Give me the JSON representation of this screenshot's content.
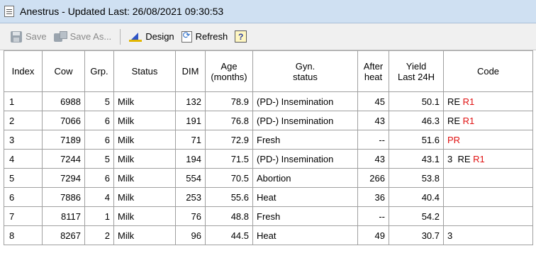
{
  "window": {
    "title": "Anestrus - Updated Last: 26/08/2021 09:30:53"
  },
  "toolbar": {
    "save_label": "Save",
    "save_as_label": "Save As...",
    "design_label": "Design",
    "refresh_label": "Refresh",
    "help_label": "?"
  },
  "icons": {
    "save": "save-icon",
    "save_as": "save-as-icon",
    "design": "design-icon",
    "refresh": "refresh-icon",
    "help": "help-icon",
    "window": "document-icon"
  },
  "colors": {
    "title_bar": "#cfe0f2",
    "code_highlight": "#e01010"
  },
  "table": {
    "headers": {
      "index": "Index",
      "cow": "Cow",
      "grp": "Grp.",
      "status": "Status",
      "dim": "DIM",
      "age_1": "Age",
      "age_2": "(months)",
      "gyn_1": "Gyn.",
      "gyn_2": "status",
      "after_1": "After",
      "after_2": "heat",
      "yield_1": "Yield",
      "yield_2": "Last 24H",
      "code": "Code"
    },
    "rows": [
      {
        "index": "1",
        "cow": "6988",
        "grp": "5",
        "status": "Milk",
        "dim": "132",
        "age": "78.9",
        "gyn": "(PD-) Insemination",
        "after_heat": "45",
        "yield": "50.1",
        "code_black": "RE ",
        "code_red": "R1"
      },
      {
        "index": "2",
        "cow": "7066",
        "grp": "6",
        "status": "Milk",
        "dim": "191",
        "age": "76.8",
        "gyn": "(PD-) Insemination",
        "after_heat": "43",
        "yield": "46.3",
        "code_black": "RE ",
        "code_red": "R1"
      },
      {
        "index": "3",
        "cow": "7189",
        "grp": "6",
        "status": "Milk",
        "dim": "71",
        "age": "72.9",
        "gyn": "Fresh",
        "after_heat": "--",
        "yield": "51.6",
        "code_black": "",
        "code_red": "PR"
      },
      {
        "index": "4",
        "cow": "7244",
        "grp": "5",
        "status": "Milk",
        "dim": "194",
        "age": "71.5",
        "gyn": "(PD-) Insemination",
        "after_heat": "43",
        "yield": "43.1",
        "code_black": "3  RE ",
        "code_red": "R1"
      },
      {
        "index": "5",
        "cow": "7294",
        "grp": "6",
        "status": "Milk",
        "dim": "554",
        "age": "70.5",
        "gyn": "Abortion",
        "after_heat": "266",
        "yield": "53.8",
        "code_black": "",
        "code_red": ""
      },
      {
        "index": "6",
        "cow": "7886",
        "grp": "4",
        "status": "Milk",
        "dim": "253",
        "age": "55.6",
        "gyn": "Heat",
        "after_heat": "36",
        "yield": "40.4",
        "code_black": "",
        "code_red": ""
      },
      {
        "index": "7",
        "cow": "8117",
        "grp": "1",
        "status": "Milk",
        "dim": "76",
        "age": "48.8",
        "gyn": "Fresh",
        "after_heat": "--",
        "yield": "54.2",
        "code_black": "",
        "code_red": ""
      },
      {
        "index": "8",
        "cow": "8267",
        "grp": "2",
        "status": "Milk",
        "dim": "96",
        "age": "44.5",
        "gyn": "Heat",
        "after_heat": "49",
        "yield": "30.7",
        "code_black": "3",
        "code_red": ""
      }
    ]
  }
}
